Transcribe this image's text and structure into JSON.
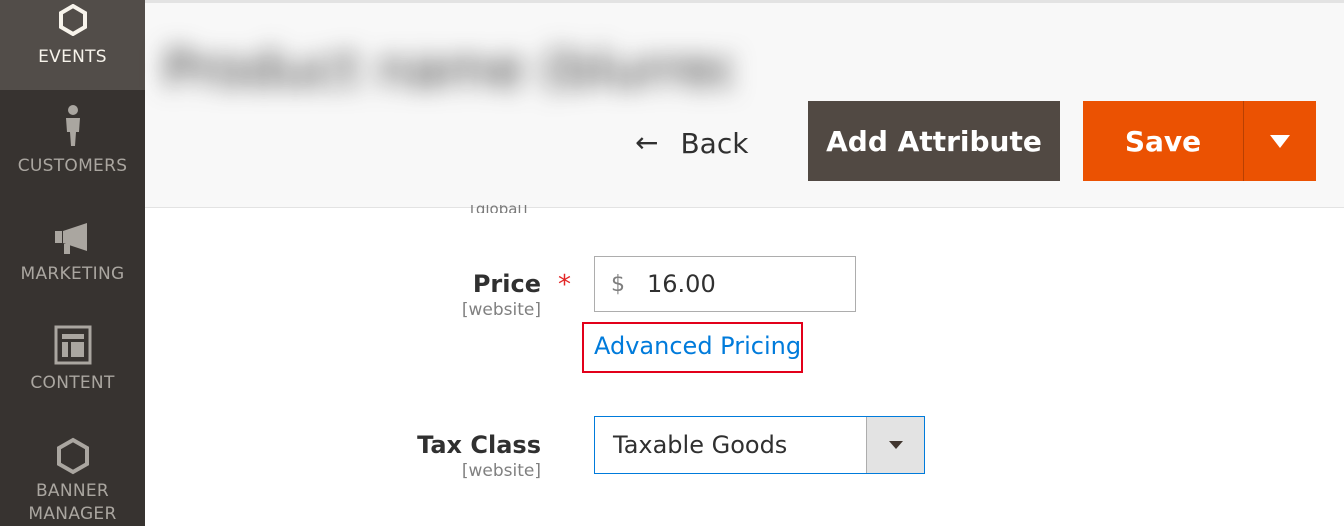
{
  "sidebar": {
    "items": [
      {
        "label": "EVENTS",
        "icon": "hexagon-icon",
        "active": true
      },
      {
        "label": "CUSTOMERS",
        "icon": "person-icon"
      },
      {
        "label": "MARKETING",
        "icon": "megaphone-icon"
      },
      {
        "label": "CONTENT",
        "icon": "layout-icon"
      },
      {
        "label": "BANNER",
        "label2": "MANAGER",
        "icon": "hexagon-icon"
      }
    ]
  },
  "header": {
    "title": "Product name (blurred)",
    "back_label": "Back",
    "add_attribute_label": "Add Attribute",
    "save_label": "Save"
  },
  "form": {
    "scope_fragment": "[global]",
    "price": {
      "label": "Price",
      "scope": "[website]",
      "required_mark": "*",
      "currency": "$",
      "value": "16.00",
      "advanced_link": "Advanced Pricing"
    },
    "tax_class": {
      "label": "Tax Class",
      "scope": "[website]",
      "value": "Taxable Goods"
    }
  },
  "colors": {
    "sidebar_bg": "#373330",
    "sidebar_active": "#524d49",
    "primary_button": "#eb5202",
    "secondary_button": "#514943",
    "link": "#007bdb",
    "highlight_border": "#e2001a"
  }
}
